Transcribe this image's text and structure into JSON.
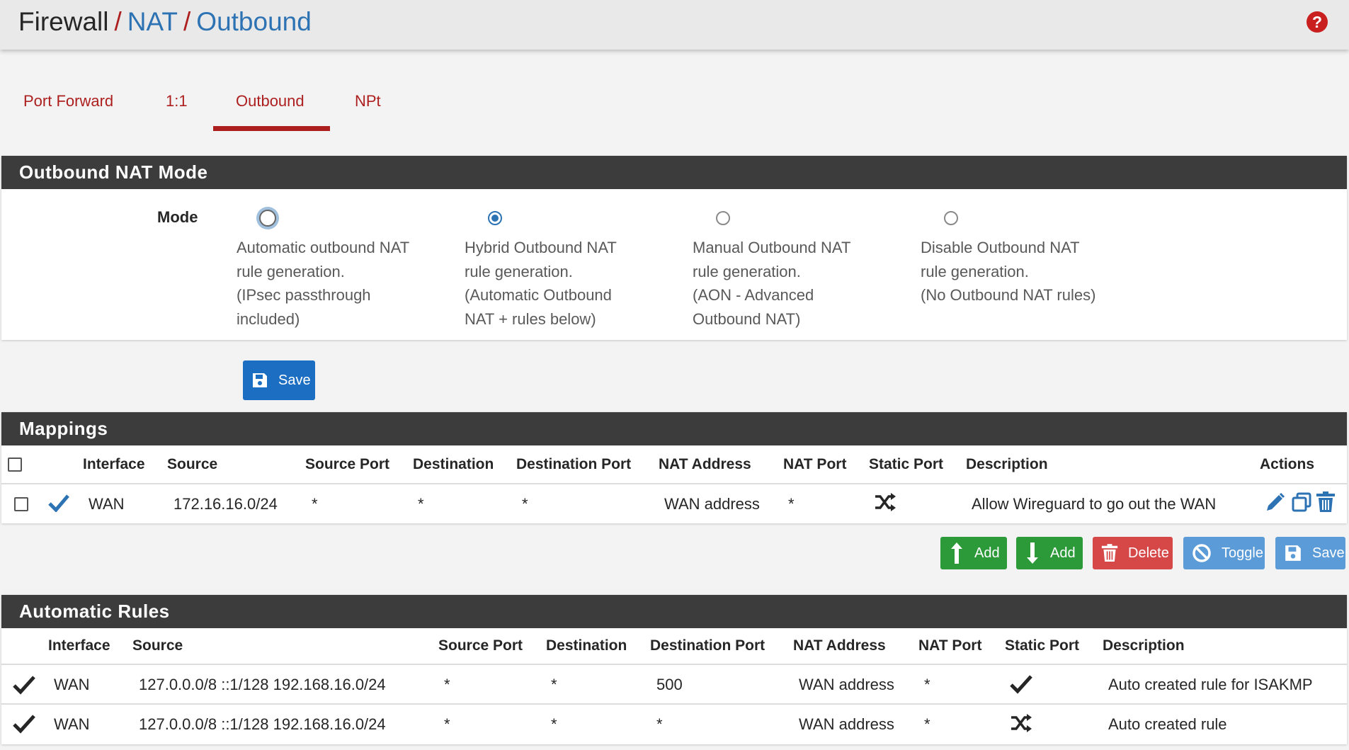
{
  "breadcrumb": {
    "root": "Firewall",
    "nat": "NAT",
    "current": "Outbound",
    "separator": "/"
  },
  "help_icon": "question-circle-icon",
  "tabs": [
    {
      "label": "Port Forward",
      "active": false
    },
    {
      "label": "1:1",
      "active": false
    },
    {
      "label": "Outbound",
      "active": true
    },
    {
      "label": "NPt",
      "active": false
    }
  ],
  "mode_panel": {
    "title": "Outbound NAT Mode",
    "mode_label": "Mode",
    "options": [
      {
        "lines": [
          "Automatic outbound NAT",
          "rule generation.",
          "(IPsec passthrough",
          "included)"
        ],
        "checked": false
      },
      {
        "lines": [
          "Hybrid Outbound NAT",
          "rule generation.",
          "(Automatic Outbound",
          "NAT + rules below)"
        ],
        "checked": true
      },
      {
        "lines": [
          "Manual Outbound NAT",
          "rule generation.",
          "(AON - Advanced",
          "Outbound NAT)"
        ],
        "checked": false
      },
      {
        "lines": [
          "Disable Outbound NAT",
          "rule generation.",
          "(No Outbound NAT rules)"
        ],
        "checked": false
      }
    ],
    "save_label": "Save"
  },
  "mappings": {
    "title": "Mappings",
    "headers": {
      "interface": "Interface",
      "source": "Source",
      "source_port": "Source Port",
      "destination": "Destination",
      "destination_port": "Destination Port",
      "nat_address": "NAT Address",
      "nat_port": "NAT Port",
      "static_port": "Static Port",
      "description": "Description",
      "actions": "Actions"
    },
    "rows": [
      {
        "enabled": true,
        "interface": "WAN",
        "source": "172.16.16.0/24",
        "source_port": "*",
        "destination": "*",
        "destination_port": "*",
        "nat_address": "WAN address",
        "nat_port": "*",
        "static_port_icon": "shuffle-icon",
        "description": "Allow Wireguard to go out the WAN"
      }
    ],
    "buttons": {
      "add_top": "Add",
      "add_bottom": "Add",
      "delete": "Delete",
      "toggle": "Toggle",
      "save": "Save"
    }
  },
  "automatic_rules": {
    "title": "Automatic Rules",
    "headers": {
      "interface": "Interface",
      "source": "Source",
      "source_port": "Source Port",
      "destination": "Destination",
      "destination_port": "Destination Port",
      "nat_address": "NAT Address",
      "nat_port": "NAT Port",
      "static_port": "Static Port",
      "description": "Description"
    },
    "rows": [
      {
        "interface": "WAN",
        "source": "127.0.0.0/8 ::1/128 192.168.16.0/24",
        "source_port": "*",
        "destination": "*",
        "destination_port": "500",
        "nat_address": "WAN address",
        "nat_port": "*",
        "static_port_icon": "check-icon",
        "description": "Auto created rule for ISAKMP"
      },
      {
        "interface": "WAN",
        "source": "127.0.0.0/8 ::1/128 192.168.16.0/24",
        "source_port": "*",
        "destination": "*",
        "destination_port": "*",
        "nat_address": "WAN address",
        "nat_port": "*",
        "static_port_icon": "shuffle-icon",
        "description": "Auto created rule"
      }
    ]
  },
  "colors": {
    "brand_red": "#ad1f1f",
    "link_blue": "#2d73b4",
    "panel_header": "#3c3c3c",
    "btn_green": "#2d9a3a",
    "btn_red": "#d64848",
    "btn_blue": "#1b6ec2",
    "btn_light_blue": "#5a9bd8"
  }
}
